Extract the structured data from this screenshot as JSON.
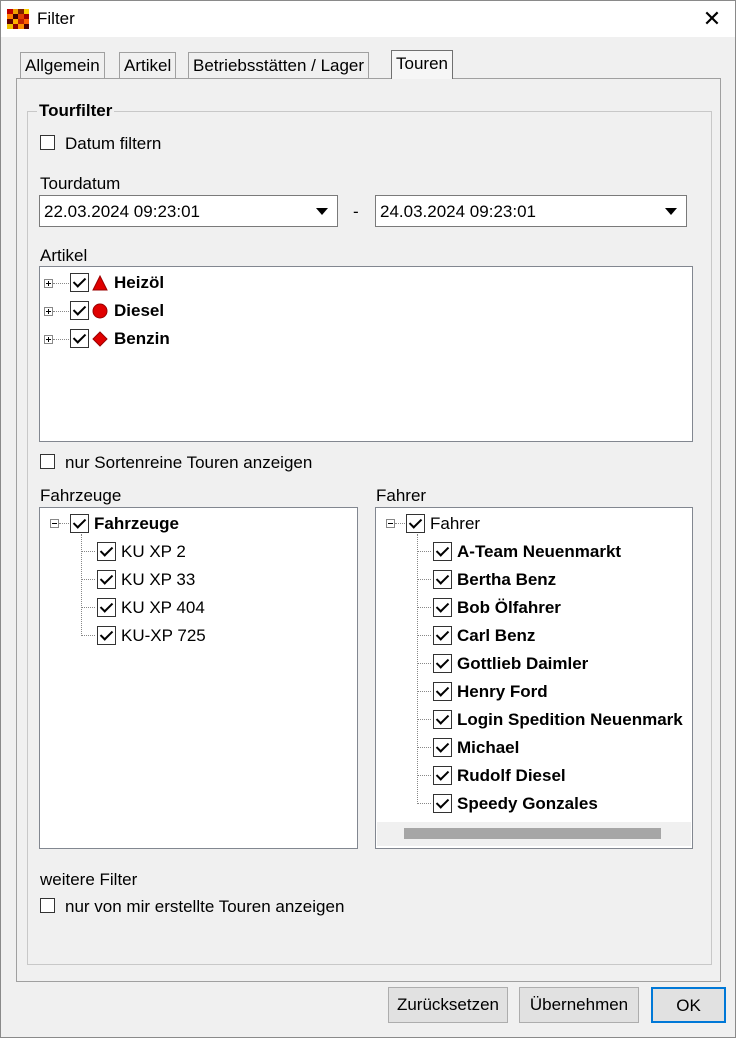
{
  "window": {
    "title": "Filter",
    "close_glyph": "✕"
  },
  "tabs": [
    "Allgemein",
    "Artikel",
    "Betriebsstätten / Lager",
    "Touren"
  ],
  "active_tab": "Touren",
  "tourfilter": {
    "legend": "Tourfilter",
    "date_filter_label": "Datum filtern",
    "date_filter_checked": false,
    "tourdatum_label": "Tourdatum",
    "date_from": "22.03.2024 09:23:01",
    "separator": "-",
    "date_to": "24.03.2024 09:23:01",
    "artikel_label": "Artikel",
    "artikel": [
      {
        "label": "Heizöl",
        "icon": "red-triangle-icon",
        "color": "#e00000"
      },
      {
        "label": "Diesel",
        "icon": "red-circle-icon",
        "color": "#e00000"
      },
      {
        "label": "Benzin",
        "icon": "red-diamond-icon",
        "color": "#e00000"
      }
    ],
    "sortenrein_label": "nur Sortenreine Touren anzeigen",
    "fahrzeuge_label": "Fahrzeuge",
    "fahrzeuge_root": "Fahrzeuge",
    "fahrzeuge": [
      "KU XP 2",
      "KU XP 33",
      "KU XP 404",
      "KU-XP 725"
    ],
    "fahrer_label": "Fahrer",
    "fahrer_root": "Fahrer",
    "fahrer": [
      "A-Team Neuenmarkt",
      "Bertha Benz",
      "Bob Ölfahrer",
      "Carl Benz",
      "Gottlieb Daimler",
      "Henry Ford",
      "Login Spedition Neuenmark",
      "Michael",
      "Rudolf Diesel",
      "Speedy Gonzales"
    ],
    "weitere_label": "weitere Filter",
    "own_tours_label": "nur von mir erstellte Touren anzeigen"
  },
  "buttons": {
    "reset": "Zurücksetzen",
    "apply": "Übernehmen",
    "ok": "OK"
  }
}
